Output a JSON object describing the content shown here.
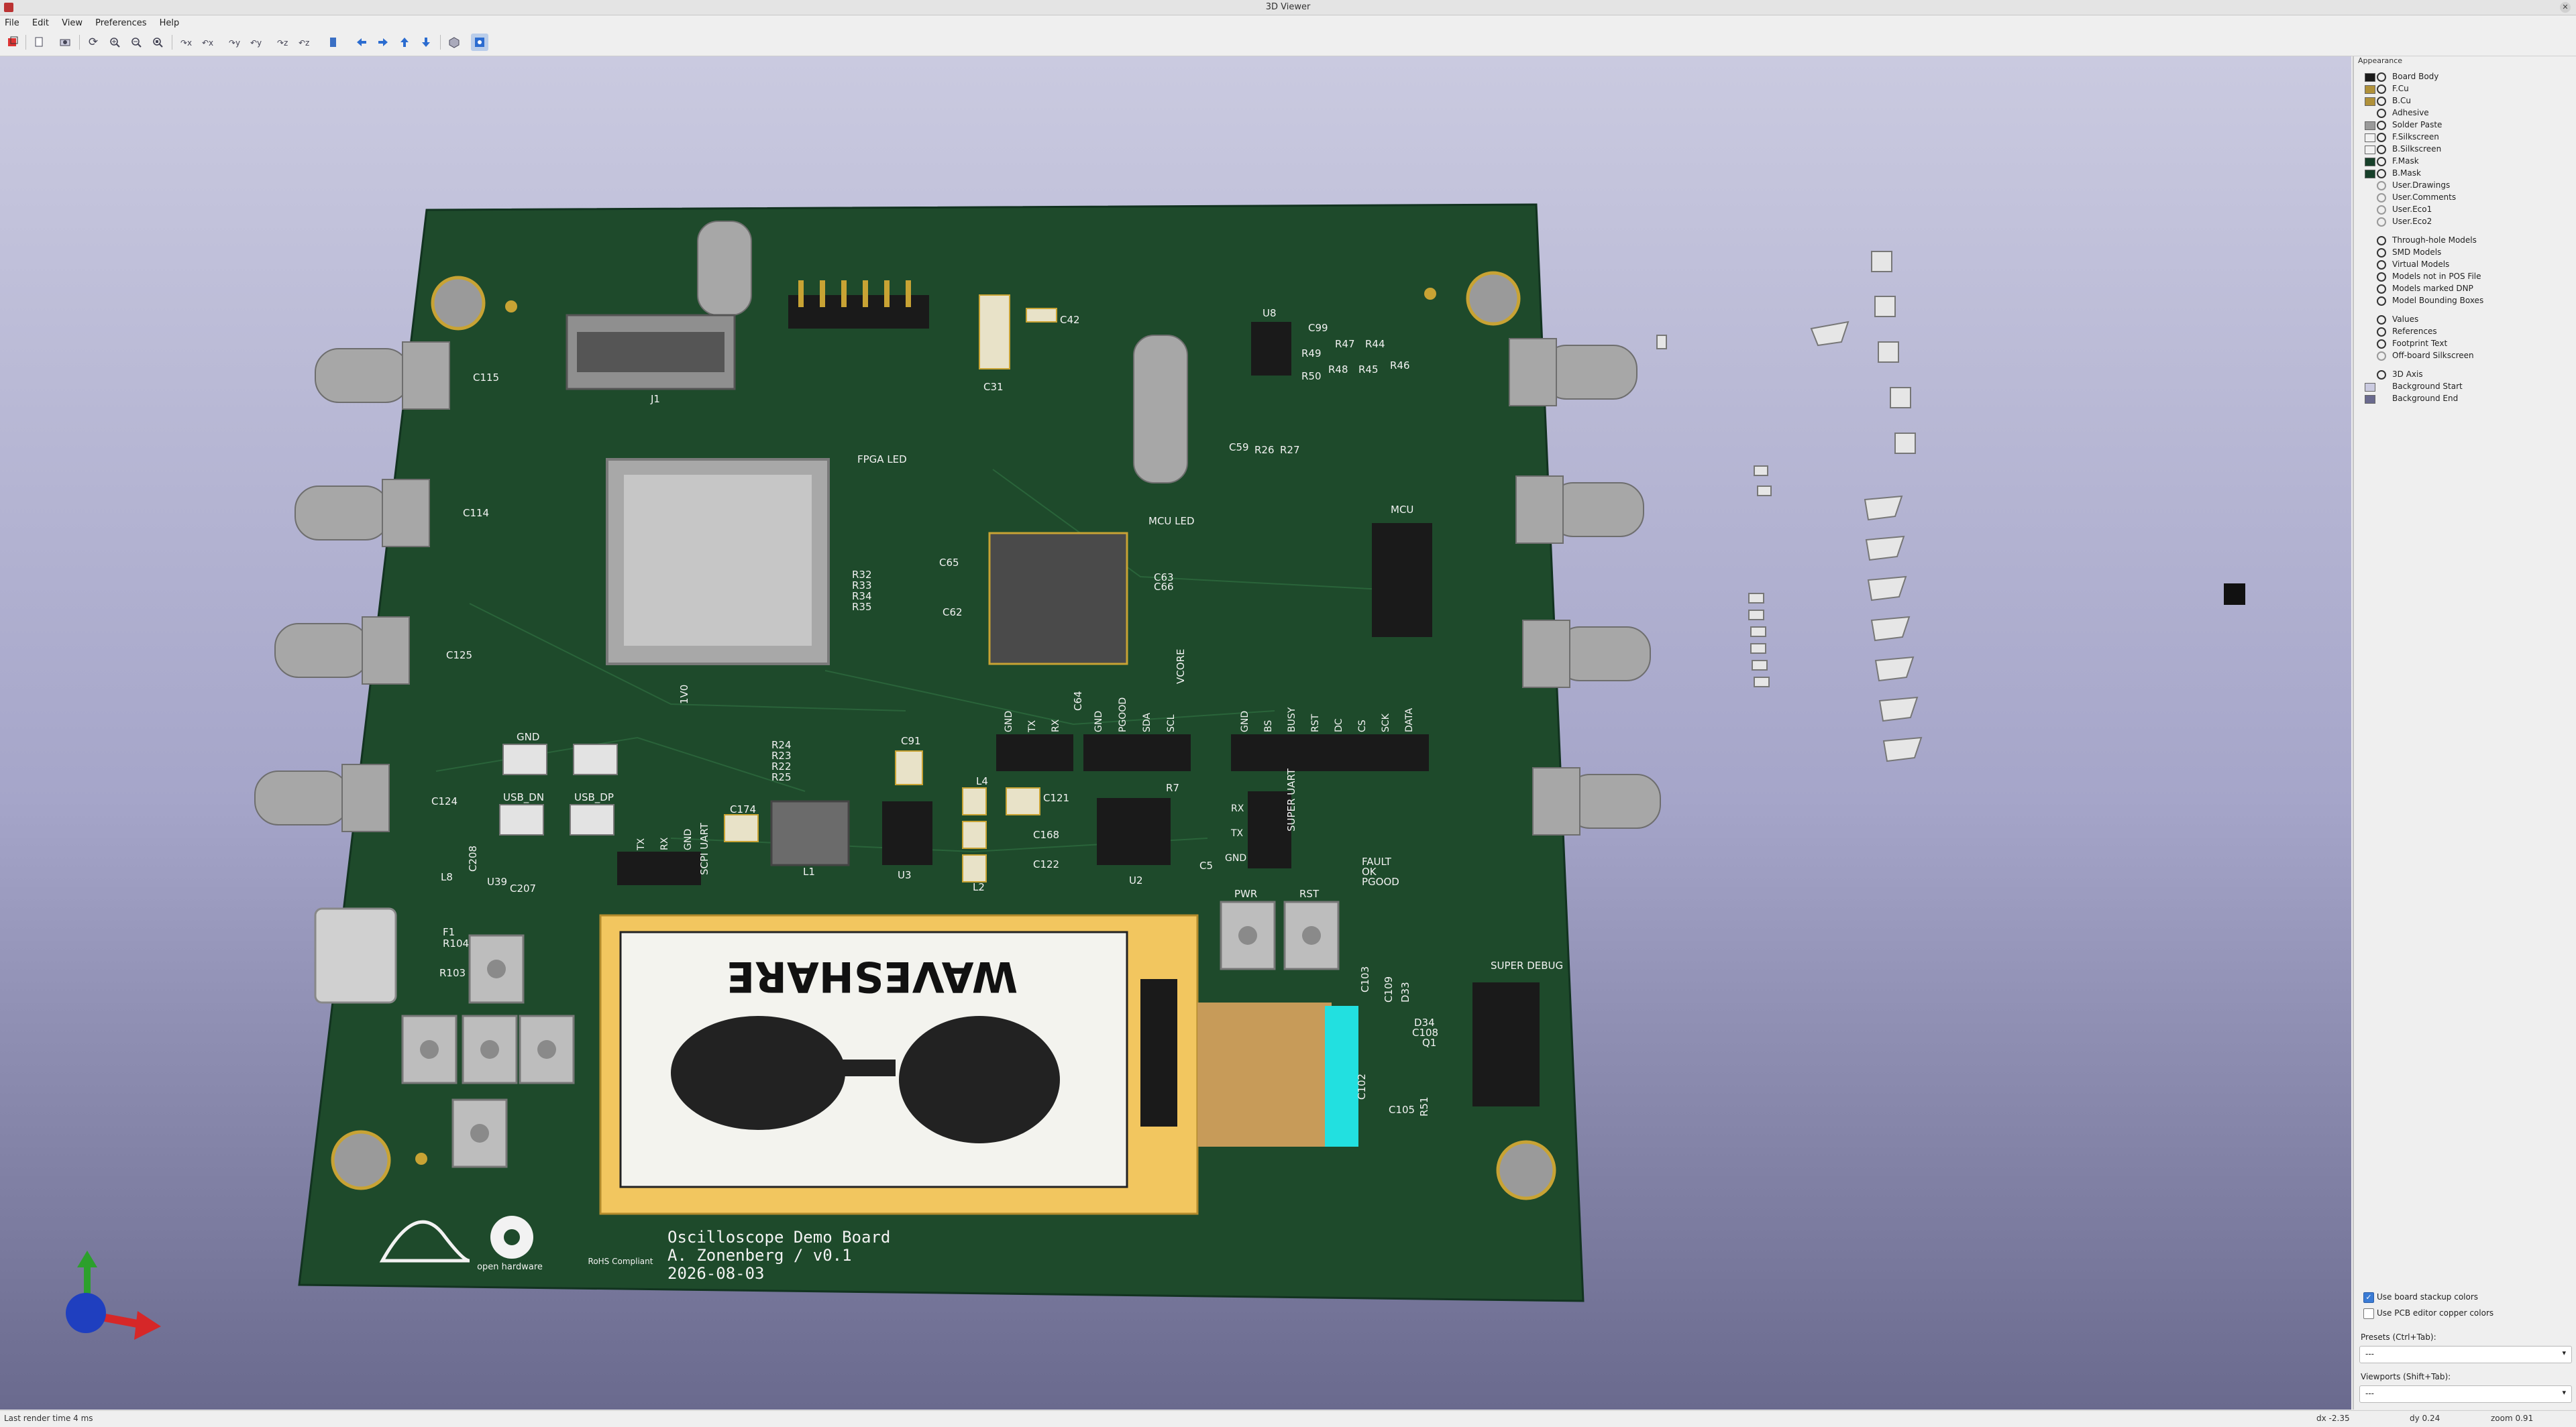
{
  "window": {
    "title": "3D Viewer"
  },
  "menu": [
    "File",
    "Edit",
    "View",
    "Preferences",
    "Help"
  ],
  "toolbar_icons": [
    "render-icon",
    "copy-icon",
    "clipboard-icon",
    "reload-icon",
    "zoom-in-icon",
    "zoom-out-icon",
    "zoom-fit-icon",
    "rotate-x-cw-icon",
    "rotate-x-ccw-icon",
    "rotate-y-cw-icon",
    "rotate-y-ccw-icon",
    "rotate-z-cw-icon",
    "rotate-z-ccw-icon",
    "flip-board-icon",
    "pan-left-icon",
    "pan-right-icon",
    "pan-up-icon",
    "pan-down-icon",
    "orthographic-icon",
    "layers-manager-icon"
  ],
  "panel": {
    "title": "Appearance",
    "layers": [
      {
        "name": "Board Body",
        "color": "#1a1a1a"
      },
      {
        "name": "F.Cu",
        "color": "#b0913a"
      },
      {
        "name": "B.Cu",
        "color": "#b0913a"
      },
      {
        "name": "Adhesive",
        "color": ""
      },
      {
        "name": "Solder Paste",
        "color": "#9a9a9a"
      },
      {
        "name": "F.Silkscreen",
        "color": "#f2f2f2"
      },
      {
        "name": "B.Silkscreen",
        "color": "#f2f2f2"
      },
      {
        "name": "F.Mask",
        "color": "#17402a"
      },
      {
        "name": "B.Mask",
        "color": "#17402a"
      },
      {
        "name": "User.Drawings",
        "color": "",
        "off": true
      },
      {
        "name": "User.Comments",
        "color": "",
        "off": true
      },
      {
        "name": "User.Eco1",
        "color": "",
        "off": true
      },
      {
        "name": "User.Eco2",
        "color": "",
        "off": true
      }
    ],
    "models": [
      "Through-hole Models",
      "SMD Models",
      "Virtual Models",
      "Models not in POS File",
      "Models marked DNP",
      "Model Bounding Boxes"
    ],
    "text_items": [
      "Values",
      "References",
      "Footprint Text",
      "Off-board Silkscreen"
    ],
    "other_items": [
      {
        "name": "3D Axis",
        "color": ""
      },
      {
        "name": "Background Start",
        "color": ""
      },
      {
        "name": "Background End",
        "color": "#6a6a8e"
      }
    ],
    "use_board_stackup": "Use board stackup colors",
    "use_pcb_editor_copper": "Use PCB editor copper colors",
    "presets_label": "Presets (Ctrl+Tab):",
    "presets_value": "---",
    "viewports_label": "Viewports (Shift+Tab):",
    "viewports_value": "---"
  },
  "board": {
    "title_line1": "Oscilloscope Demo Board",
    "title_line2": "A. Zonenberg / v0.1",
    "title_line3": "2026-08-03",
    "display_brand": "WAVESHARE",
    "refs": [
      "C115",
      "C114",
      "C125",
      "C124",
      "J1",
      "C31",
      "C42",
      "U8",
      "C99",
      "R47",
      "R44",
      "R49",
      "R48",
      "R45",
      "R46",
      "R50",
      "C59",
      "R26",
      "R27",
      "FPGA LED",
      "R32",
      "R33",
      "R34",
      "R35",
      "C65",
      "C62",
      "MCU LED",
      "C63",
      "C66",
      "MCU",
      "VCORE",
      "1V0",
      "R24",
      "R23",
      "R22",
      "R25",
      "C91",
      "GND",
      "USB_DN",
      "USB_DP",
      "C174",
      "L1",
      "U3",
      "L4",
      "C121",
      "C168",
      "C122",
      "L2",
      "U2",
      "C5",
      "R7",
      "SUPER UART",
      "FAULT",
      "OK",
      "PGOOD",
      "SCPI UART",
      "L8",
      "U39",
      "C208",
      "C207",
      "F1",
      "R104",
      "R103",
      "PWR",
      "RST",
      "SUPER DEBUG",
      "C103",
      "C109",
      "D33",
      "D34",
      "C108",
      "Q1",
      "C102",
      "C105",
      "R51",
      "C64"
    ],
    "header_labels": {
      "mcu_uart": [
        "GND",
        "TX",
        "RX"
      ],
      "super_status": [
        "GND",
        "PGOOD",
        "SDA",
        "SCL"
      ],
      "display": [
        "GND",
        "BS",
        "BUSY",
        "RST",
        "DC",
        "CS",
        "SCK",
        "DATA"
      ],
      "scpi_uart": [
        "TX",
        "RX",
        "GND"
      ],
      "super_uart": [
        "RX",
        "TX",
        "GND"
      ]
    },
    "logos": [
      "open hardware",
      "RoHS Compliant"
    ]
  },
  "status": {
    "left": "Last render time 4 ms",
    "dx": "dx -2.35",
    "dy": "dy 0.24",
    "zoom": "zoom 0.91"
  }
}
